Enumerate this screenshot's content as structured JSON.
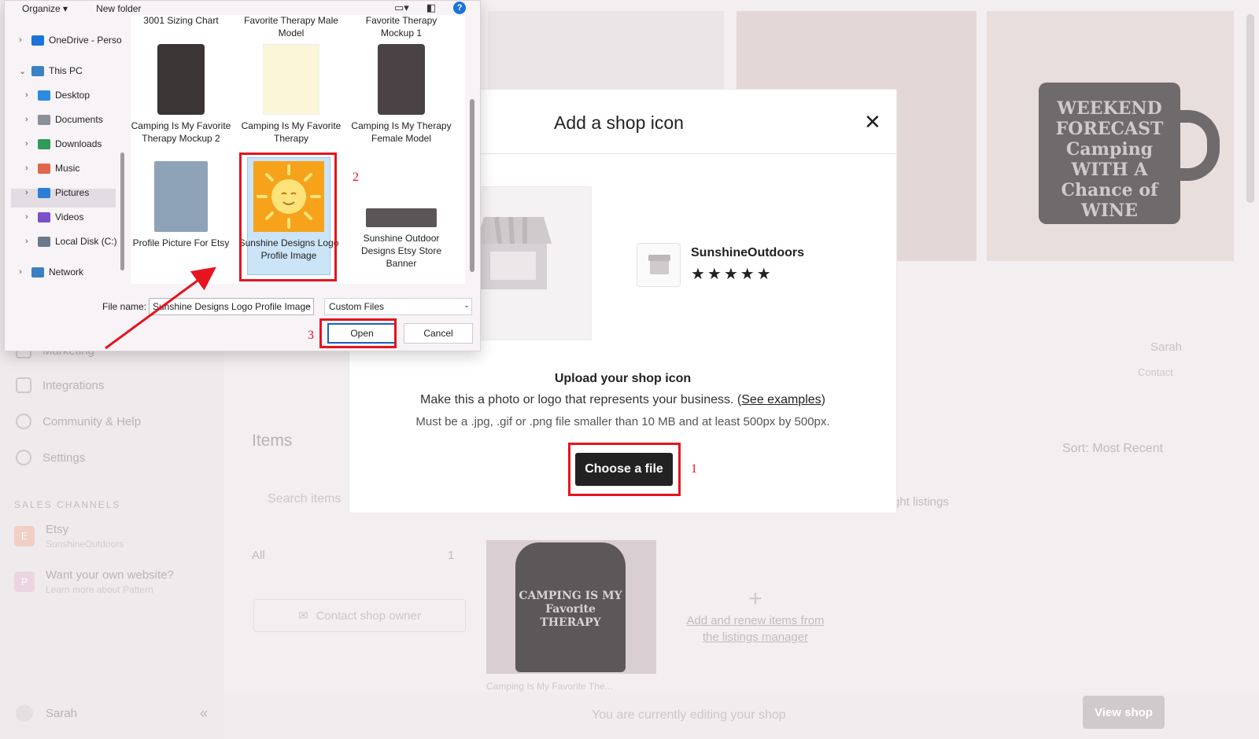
{
  "background": {
    "sidebar": {
      "items": [
        {
          "label": "Marketing",
          "top": 0
        },
        {
          "label": "Integrations"
        },
        {
          "label": "Community & Help"
        },
        {
          "label": "Settings"
        }
      ],
      "sales_channels_heading": "SALES CHANNELS",
      "channels": [
        {
          "initial": "E",
          "title": "Etsy",
          "subtitle": "SunshineOutdoors"
        },
        {
          "initial": "P",
          "title": "Want your own website?",
          "subtitle": "Learn more about Pattern"
        }
      ],
      "user_name": "Sarah",
      "collapse_glyph": "«"
    },
    "shop_owner": {
      "name": "Sarah",
      "contact": "Contact"
    },
    "items_title": "Items",
    "search_placeholder": "Search items",
    "listings_hint": "ght listings",
    "sort_label": "Sort: Most Recent",
    "all_label": "All",
    "all_count": "1",
    "contact_owner": "Contact shop owner",
    "listing": {
      "shirt_text": "CAMPING IS MY Favorite THERAPY",
      "caption": "Camping Is My Favorite The..."
    },
    "mug_text": "WEEKEND FORECAST Camping WITH A Chance of WINE",
    "add_card": {
      "plus": "+",
      "link": "Add and renew items from the listings manager"
    },
    "footer_text": "You are currently editing your shop",
    "view_shop": "View shop"
  },
  "modal": {
    "title": "Add a shop icon",
    "close": "✕",
    "shop_name": "SunshineOutdoors",
    "stars": "★★★★★",
    "upload_heading": "Upload your shop icon",
    "upload_desc_before": "Make this a photo or logo that represents your business. (",
    "upload_desc_link": "See examples",
    "upload_desc_after": ")",
    "upload_requirements": "Must be a .jpg, .gif or .png file smaller than 10 MB and at least 500px by 500px.",
    "choose_button": "Choose a file"
  },
  "dialog": {
    "toolbar": {
      "organize": "Organize ▾",
      "new_folder": "New folder",
      "help": "?"
    },
    "nav": [
      {
        "label": "OneDrive - Perso",
        "caret": "›",
        "icon_color": "#1a73d9"
      },
      {
        "label": "This PC",
        "caret": "⌄",
        "icon_color": "#3b82c4"
      },
      {
        "label": "Desktop",
        "caret": "›",
        "icon_color": "#2a8be0"
      },
      {
        "label": "Documents",
        "caret": "›",
        "icon_color": "#8a8f98"
      },
      {
        "label": "Downloads",
        "caret": "›",
        "icon_color": "#2f9a5a"
      },
      {
        "label": "Music",
        "caret": "›",
        "icon_color": "#e0664a"
      },
      {
        "label": "Pictures",
        "caret": "›",
        "icon_color": "#2a7fd4"
      },
      {
        "label": "Videos",
        "caret": "›",
        "icon_color": "#7b4fc9"
      },
      {
        "label": "Local Disk (C:)",
        "caret": "›",
        "icon_color": "#6a7a8a"
      },
      {
        "label": "Network",
        "caret": "›",
        "icon_color": "#3a7fc4"
      }
    ],
    "partial_files": [
      {
        "label": "3001 Sizing Chart"
      },
      {
        "label": "Favorite Therapy Male Model"
      },
      {
        "label": "Favorite Therapy Mockup 1"
      }
    ],
    "files": [
      {
        "label": "Camping Is My Favorite Therapy Mockup 2"
      },
      {
        "label": "Camping Is My Favorite Therapy"
      },
      {
        "label": "Camping Is My Therapy Female Model"
      },
      {
        "label": "Profile Picture For Etsy"
      },
      {
        "label": "Sunshine Designs Logo Profile Image"
      },
      {
        "label": "Sunshine Outdoor Designs Etsy Store Banner"
      }
    ],
    "file_name_label": "File name:",
    "file_name_value": "Sunshine Designs Logo Profile Image",
    "file_type": "Custom Files",
    "open_button": "Open",
    "cancel_button": "Cancel"
  },
  "annotations": {
    "step1": "1",
    "step2": "2",
    "step3": "3"
  },
  "colors": {
    "annotation_red": "#e5141e",
    "etsy_dark_button": "#222222",
    "selection_blue": "#cce4f7",
    "sun_orange": "#f6a31b",
    "sun_yellow": "#fbe37a"
  }
}
